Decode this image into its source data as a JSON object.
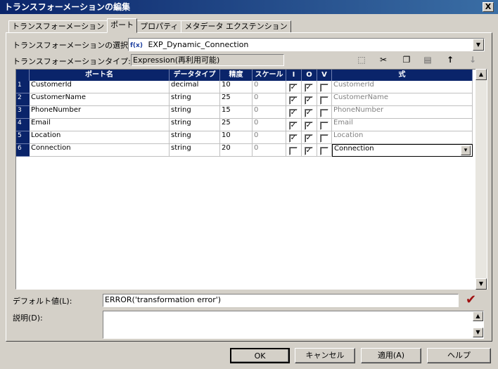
{
  "window": {
    "title": "トランスフォーメーションの編集",
    "close_label": "X"
  },
  "tabs": [
    {
      "label": "トランスフォーメーション"
    },
    {
      "label": "ポート"
    },
    {
      "label": "プロパティ"
    },
    {
      "label": "メタデータ エクステンション"
    }
  ],
  "select_label": "トランスフォーメーションの選択(S):",
  "select_value": "EXP_Dynamic_Connection",
  "select_icon": "f(x)",
  "type_label": "トランスフォーメーションタイプ:",
  "type_value": "Expression(再利用可能)",
  "toolbar": {
    "icons": [
      "new-port-icon",
      "cut-icon",
      "copy-icon",
      "paste-icon",
      "move-up-icon",
      "move-down-icon"
    ]
  },
  "grid": {
    "headers": [
      "ポート名",
      "データタイプ",
      "精度",
      "スケール",
      "I",
      "O",
      "V",
      "式"
    ],
    "rows": [
      {
        "no": "1",
        "name": "CustomerId",
        "type": "decimal",
        "precision": "10",
        "scale": "0",
        "i": true,
        "o": true,
        "v": false,
        "expr": "CustomerId"
      },
      {
        "no": "2",
        "name": "CustomerName",
        "type": "string",
        "precision": "25",
        "scale": "0",
        "i": true,
        "o": true,
        "v": false,
        "expr": "CustomerName"
      },
      {
        "no": "3",
        "name": "PhoneNumber",
        "type": "string",
        "precision": "15",
        "scale": "0",
        "i": true,
        "o": true,
        "v": false,
        "expr": "PhoneNumber"
      },
      {
        "no": "4",
        "name": "Email",
        "type": "string",
        "precision": "25",
        "scale": "0",
        "i": true,
        "o": true,
        "v": false,
        "expr": "Email"
      },
      {
        "no": "5",
        "name": "Location",
        "type": "string",
        "precision": "10",
        "scale": "0",
        "i": true,
        "o": true,
        "v": false,
        "expr": "Location"
      },
      {
        "no": "6",
        "name": "Connection",
        "type": "string",
        "precision": "20",
        "scale": "0",
        "i": false,
        "o": true,
        "v": false,
        "expr": "Connection"
      }
    ]
  },
  "default_label": "デフォルト値(L):",
  "default_value": "ERROR('transformation error')",
  "description_label": "説明(D):",
  "description_value": "",
  "buttons": {
    "ok": "OK",
    "cancel": "キャンセル",
    "apply": "適用(A)",
    "help": "ヘルプ"
  }
}
